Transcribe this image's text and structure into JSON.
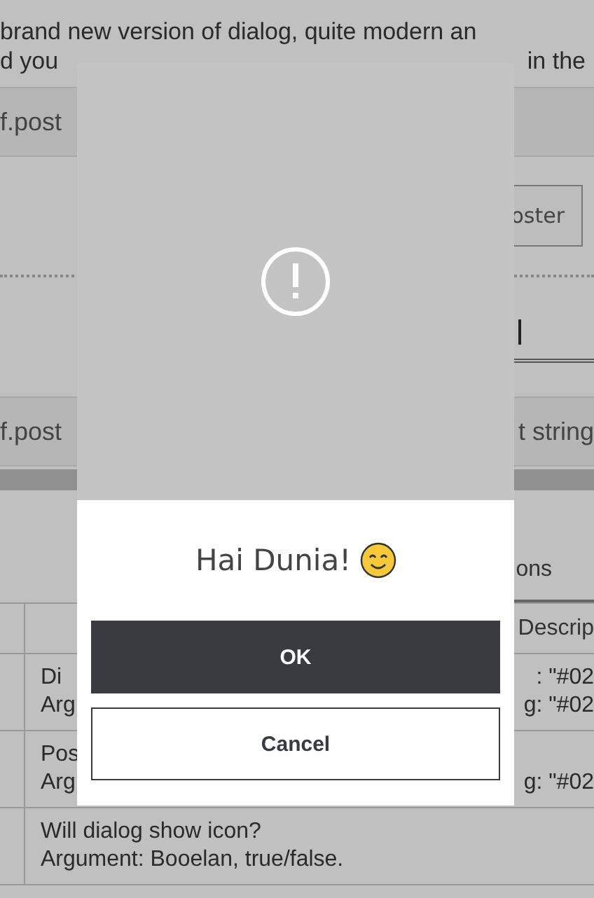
{
  "intro": {
    "line_1": "brand new version of dialog, quite modern an",
    "line_2": {
      "left": "d you",
      "right": "in the"
    }
  },
  "band_1": {
    "label": "f.post"
  },
  "poster_button": {
    "label": "oster"
  },
  "band_2": {
    "left": "f.post",
    "right": "t string"
  },
  "tab": {
    "label": "ons"
  },
  "table": {
    "header": {
      "column_2": "Descrip"
    },
    "rows": [
      {
        "lines": [
          {
            "left": "Di",
            "right": ": \"#02"
          },
          {
            "left": "Arg",
            "right": "g: \"#02"
          }
        ]
      },
      {
        "lines": [
          {
            "left": "Pos"
          },
          {
            "left": "Arg",
            "right": "g: \"#02"
          }
        ]
      },
      {
        "lines": [
          {
            "left": "Will dialog show icon?"
          },
          {
            "left": "Argument: Booelan, true/false."
          }
        ]
      }
    ]
  },
  "dialog": {
    "message": "Hai Dunia!",
    "buttons": [
      {
        "label": "OK",
        "kind": "primary"
      },
      {
        "label": "Cancel",
        "kind": "secondary"
      }
    ]
  }
}
